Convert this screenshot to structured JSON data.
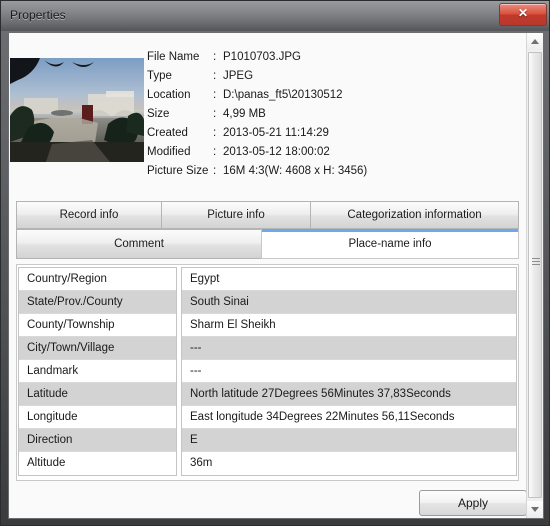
{
  "window": {
    "title": "Properties",
    "close_label": "✕"
  },
  "thumbnail": {
    "alt": "Sunset view over resort terrace and sea"
  },
  "metadata": [
    {
      "key": "File Name",
      "sep": ":",
      "value": "P1010703.JPG"
    },
    {
      "key": "Type",
      "sep": ":",
      "value": "JPEG"
    },
    {
      "key": "Location",
      "sep": ":",
      "value": "D:\\panas_ft5\\20130512"
    },
    {
      "key": "Size",
      "sep": ":",
      "value": "4,99 MB"
    },
    {
      "key": "Created",
      "sep": ":",
      "value": "2013-05-21 11:14:29"
    },
    {
      "key": "Modified",
      "sep": ":",
      "value": "2013-05-12 18:00:02"
    },
    {
      "key": "Picture Size",
      "sep": ":",
      "value": "16M 4:3(W: 4608 x H: 3456)"
    }
  ],
  "tabs": {
    "row1": [
      {
        "label": "Record info",
        "active": false
      },
      {
        "label": "Picture info",
        "active": false
      },
      {
        "label": "Categorization information",
        "active": false
      }
    ],
    "row2": [
      {
        "label": "Comment",
        "active": false
      },
      {
        "label": "Place-name info",
        "active": true
      }
    ]
  },
  "place_name_info": {
    "rows": [
      {
        "label": "Country/Region",
        "value": "Egypt"
      },
      {
        "label": "State/Prov./County",
        "value": "South Sinai"
      },
      {
        "label": "County/Township",
        "value": "Sharm El Sheikh"
      },
      {
        "label": "City/Town/Village",
        "value": "---"
      },
      {
        "label": "Landmark",
        "value": "---"
      },
      {
        "label": "Latitude",
        "value": "North latitude 27Degrees 56Minutes 37,83Seconds"
      },
      {
        "label": "Longitude",
        "value": "East longitude 34Degrees 22Minutes 56,11Seconds"
      },
      {
        "label": "Direction",
        "value": "E"
      },
      {
        "label": "Altitude",
        "value": "36m"
      }
    ]
  },
  "footer": {
    "apply_label": "Apply"
  },
  "colors": {
    "accent": "#6fa8e8",
    "close_red": "#c3392b",
    "alt_row": "#d3d3d3"
  }
}
